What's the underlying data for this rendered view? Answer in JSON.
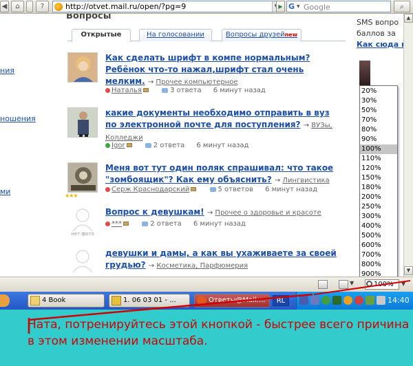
{
  "browser": {
    "url": "http://otvet.mail.ru/open/?pg=9",
    "search_placeholder": "Google"
  },
  "left_links": [
    "ния",
    "ношения",
    "ми"
  ],
  "main": {
    "section_title": "Вопросы",
    "tabs": [
      {
        "label": "Открытые",
        "active": true
      },
      {
        "label": "На голосовании",
        "active": false
      },
      {
        "label": "Вопросы друзей",
        "badge": "new",
        "active": false
      }
    ],
    "questions": [
      {
        "title": "Как сделать шрифт в компе нормальным? Ребёнок что-то нажал,шрифт стал очень мелким.",
        "category": "Прочее компьютерное",
        "author": "Наталья",
        "answers": "3 ответа",
        "time": "6 минут назад"
      },
      {
        "title": "какие документы необходимо отправить в вуз по электронной почте для поступления?",
        "category": "ВУЗы, Колледжи",
        "author": "Igor",
        "answers": "2 ответа",
        "time": "6 минут назад"
      },
      {
        "title": "Меня вот тут один поляк спрашивал: что такое \"зомбоящик\"? Как ему объяснить?",
        "category": "Лингвистика",
        "author": "Серж Краснодарский",
        "answers": "5 ответов",
        "time": "6 минут назад"
      },
      {
        "title": "Вопрос к девушкам!",
        "category": "Прочее о здоровье и красоте",
        "author": "***",
        "answers": "2 ответа",
        "time": "6 минут назад",
        "photo_label": "нет фото"
      },
      {
        "title": "девушки и дамы, а как вы ухаживаете за своей грудью?",
        "category": "Косметика, Парфюмерия"
      }
    ]
  },
  "right_col": {
    "line1": "SMS вопро",
    "line2": "баллов за",
    "link": "Как сюда п"
  },
  "zoom_menu": {
    "options": [
      "20%",
      "30%",
      "50%",
      "70%",
      "80%",
      "90%",
      "100%",
      "110%",
      "120%",
      "150%",
      "180%",
      "200%",
      "250%",
      "300%",
      "400%",
      "500%",
      "600%",
      "700%",
      "800%",
      "900%"
    ],
    "selected": "100%"
  },
  "statusbar": {
    "zoom": "100%"
  },
  "taskbar": {
    "items": [
      {
        "label": "4 Book"
      },
      {
        "label": "1. 06 03 01 - ..."
      },
      {
        "label": "Ответы@Mail...."
      }
    ],
    "lang": "RL",
    "clock": "14:40"
  },
  "caption": "Ната, потренируйтесь этой кнопкой - быстрее всего причина в этом изменении масштаба.",
  "colors": {
    "link": "#1e4fa8",
    "caption_bg": "#33cccc",
    "caption_text": "#d00000",
    "annotation": "#d00000"
  }
}
